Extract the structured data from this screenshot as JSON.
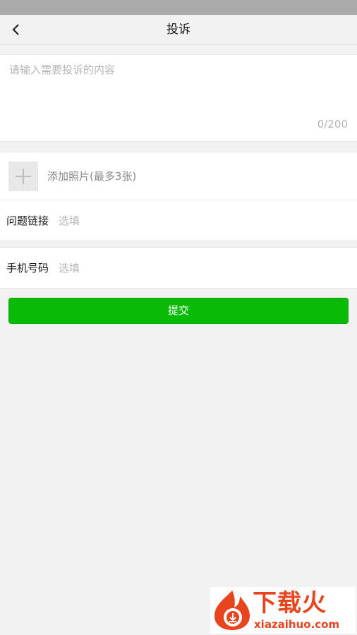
{
  "header": {
    "title": "投诉",
    "back_icon": "chevron-left-icon"
  },
  "complaint": {
    "placeholder": "请输入需要投诉的内容",
    "value": "",
    "counter": "0/200"
  },
  "photo": {
    "label": "添加照片(最多3张)",
    "icon": "plus-icon"
  },
  "link_field": {
    "label": "问题链接",
    "placeholder": "选填",
    "value": ""
  },
  "phone_field": {
    "label": "手机号码",
    "placeholder": "选填",
    "value": ""
  },
  "submit": {
    "label": "提交",
    "color": "#09bb07"
  },
  "watermark": {
    "title": "下载火",
    "url": "xiazaihuo.com",
    "color": "#e8451e"
  }
}
